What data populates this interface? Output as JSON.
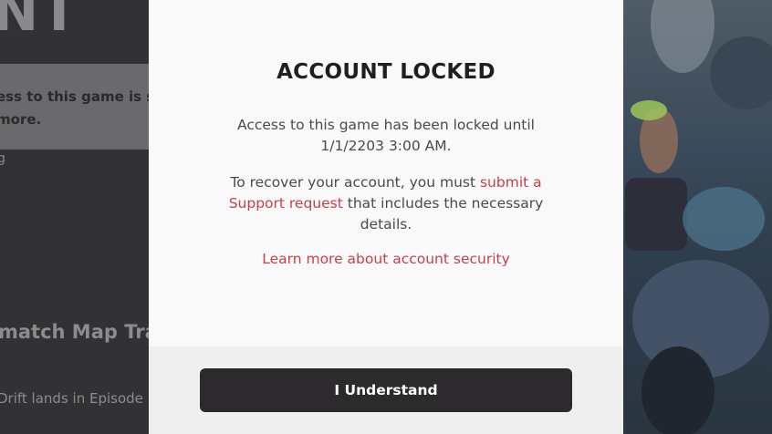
{
  "background": {
    "logo_text": "NT",
    "trademark": "™",
    "notice_line1": "ess to this game is sus",
    "notice_line2": "more.",
    "small_text": "g",
    "headline": "match Map Tra",
    "subline": "Drift lands in Episode"
  },
  "modal": {
    "title": "ACCOUNT LOCKED",
    "lock_message": "Access to this game has been locked until 1/1/2203 3:00 AM.",
    "recover_prefix": "To recover your account, you must ",
    "recover_link": "submit a Support request",
    "recover_suffix": " that includes the necessary details.",
    "learn_more_link": "Learn more about account security",
    "button_label": "I Understand"
  },
  "colors": {
    "accent_link": "#c4404a",
    "button_bg": "#2c2a2d",
    "modal_bg": "#f9f9f9",
    "footer_bg": "#efefef"
  }
}
